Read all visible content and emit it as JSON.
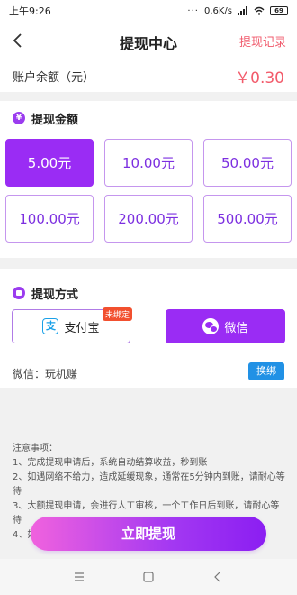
{
  "status_bar": {
    "time": "上午9:26",
    "dots": "···",
    "speed": "0.6K/s",
    "battery": "69"
  },
  "nav": {
    "title": "提现中心",
    "record": "提现记录"
  },
  "balance": {
    "label": "账户余额（元）",
    "value": "￥0.30"
  },
  "amount_section": {
    "icon": "¥",
    "title": "提现金额",
    "options": [
      "5.00元",
      "10.00元",
      "50.00元",
      "100.00元",
      "200.00元",
      "500.00元"
    ],
    "selected_index": 0
  },
  "method_section": {
    "title": "提现方式",
    "alipay_label": "支付宝",
    "alipay_logo": "支",
    "alipay_badge": "未绑定",
    "wechat_label": "微信",
    "account_text": "微信：玩机赚",
    "rebind_label": "换绑"
  },
  "notes": {
    "title": "注意事项：",
    "items": [
      "1、完成提现申请后，系统自动结算收益，秒到账",
      "2、如遇网络不给力，造成延缓现象，通常在5分钟内到账，请耐心等待",
      "3、大额提现申请，会进行人工审核，一个工作日后到账，请耐心等待",
      "4、如"
    ]
  },
  "submit_label": "立即提现",
  "colors": {
    "accent": "#9a2cf4",
    "balance": "#f25b6b",
    "rebind": "#2191e5",
    "badge": "#f2502f"
  }
}
